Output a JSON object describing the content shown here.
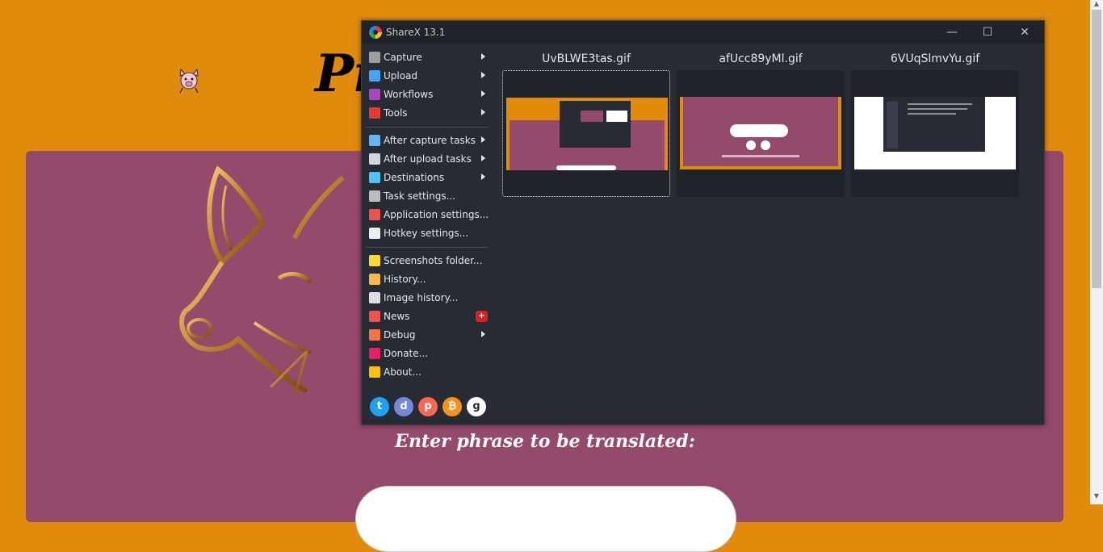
{
  "page": {
    "title_visible": "Pi",
    "prompt_heading": "Enter phrase to be translated:"
  },
  "sharex": {
    "window_title": "ShareX 13.1",
    "controls": {
      "minimize": "—",
      "maximize": "☐",
      "close": "✕"
    },
    "menu_groups": [
      [
        {
          "label": "Capture",
          "icon": "capture-icon",
          "color": "#9e9e9e",
          "submenu": true
        },
        {
          "label": "Upload",
          "icon": "upload-arrow-icon",
          "color": "#42a5f5",
          "submenu": true
        },
        {
          "label": "Workflows",
          "icon": "workflows-grid-icon",
          "color": "#ab47bc",
          "submenu": true
        },
        {
          "label": "Tools",
          "icon": "toolbox-icon",
          "color": "#e53935",
          "submenu": true
        }
      ],
      [
        {
          "label": "After capture tasks",
          "icon": "after-capture-icon",
          "color": "#64b5f6",
          "submenu": true
        },
        {
          "label": "After upload tasks",
          "icon": "cloud-upload-icon",
          "color": "#cfd8dc",
          "submenu": true
        },
        {
          "label": "Destinations",
          "icon": "globe-drive-icon",
          "color": "#4fc3f7",
          "submenu": true
        },
        {
          "label": "Task settings...",
          "icon": "gear-icon",
          "color": "#bdbdbd",
          "submenu": false
        },
        {
          "label": "Application settings...",
          "icon": "wrench-screwdriver-icon",
          "color": "#ef5350",
          "submenu": false
        },
        {
          "label": "Hotkey settings...",
          "icon": "keyboard-key-icon",
          "color": "#eeeeee",
          "submenu": false
        }
      ],
      [
        {
          "label": "Screenshots folder...",
          "icon": "folder-icon",
          "color": "#fdd835",
          "submenu": false
        },
        {
          "label": "History...",
          "icon": "history-icon",
          "color": "#ffb74d",
          "submenu": false
        },
        {
          "label": "Image history...",
          "icon": "image-history-icon",
          "color": "#e0e0e0",
          "submenu": false
        },
        {
          "label": "News",
          "icon": "megaphone-icon",
          "color": "#ef5350",
          "submenu": false,
          "badge": "+"
        },
        {
          "label": "Debug",
          "icon": "traffic-cone-icon",
          "color": "#ff7043",
          "submenu": true
        },
        {
          "label": "Donate...",
          "icon": "heart-icon",
          "color": "#e91e63",
          "submenu": false
        },
        {
          "label": "About...",
          "icon": "crown-icon",
          "color": "#ffc107",
          "submenu": false
        }
      ]
    ],
    "social": [
      {
        "name": "twitter-icon",
        "glyph": "t",
        "color": "#1da1f2"
      },
      {
        "name": "discord-icon",
        "glyph": "d",
        "color": "#7289da"
      },
      {
        "name": "patreon-icon",
        "glyph": "p",
        "color": "#f96854"
      },
      {
        "name": "bitcoin-icon",
        "glyph": "₿",
        "color": "#f7931a"
      },
      {
        "name": "github-icon",
        "glyph": "g",
        "color": "#ffffff"
      }
    ],
    "thumbnails": [
      {
        "filename": "UvBLWE3tas.gif",
        "selected": true
      },
      {
        "filename": "afUcc89yMl.gif",
        "selected": false
      },
      {
        "filename": "6VUqSlmvYu.gif",
        "selected": false
      }
    ]
  },
  "colors": {
    "page_orange": "#e08b0c",
    "panel_purple": "#944a6a",
    "sharex_bg": "#272b33"
  }
}
